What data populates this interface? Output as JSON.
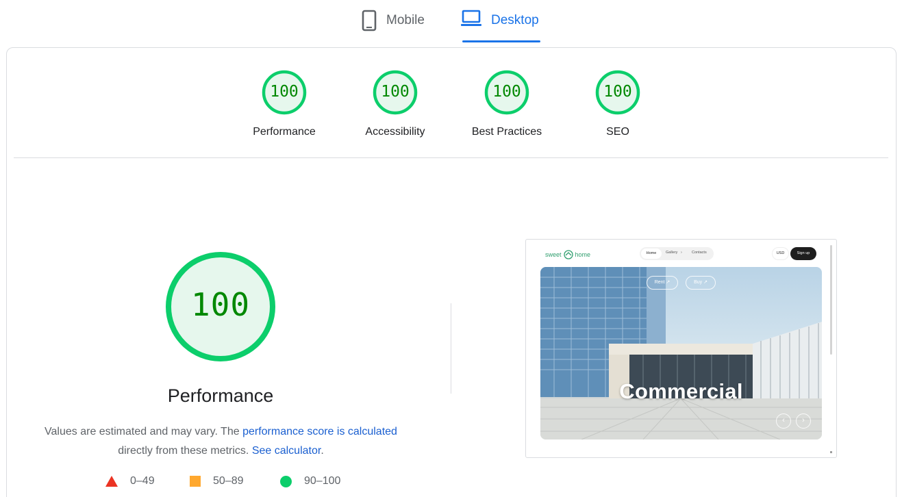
{
  "tabs": {
    "mobile_label": "Mobile",
    "desktop_label": "Desktop",
    "active": "Desktop"
  },
  "categories": [
    {
      "label": "Performance",
      "score": "100"
    },
    {
      "label": "Accessibility",
      "score": "100"
    },
    {
      "label": "Best Practices",
      "score": "100"
    },
    {
      "label": "SEO",
      "score": "100"
    }
  ],
  "performance": {
    "score": "100",
    "title": "Performance",
    "desc_part1": "Values are estimated and may vary. The ",
    "desc_link1": "performance score is calculated",
    "desc_part2": " directly from these metrics. ",
    "desc_link2": "See calculator",
    "desc_part3": "."
  },
  "legend": {
    "fail": "0–49",
    "average": "50–89",
    "pass": "90–100"
  },
  "colors": {
    "pass": "#0cce6b",
    "pass_text": "#008800",
    "pass_fill": "#e6f7ed",
    "average": "#ffa82e",
    "fail": "#eb3323",
    "accent": "#1a73e8"
  },
  "screenshot": {
    "logo_text_left": "sweet",
    "logo_text_right": "home",
    "nav_home": "Home",
    "nav_gallery": "Gallery",
    "nav_contacts": "Contacts",
    "currency": "USD",
    "signup": "Sign up",
    "pill_rent": "Rent ↗",
    "pill_buy": "Buy ↗",
    "caption": "Commercial"
  }
}
